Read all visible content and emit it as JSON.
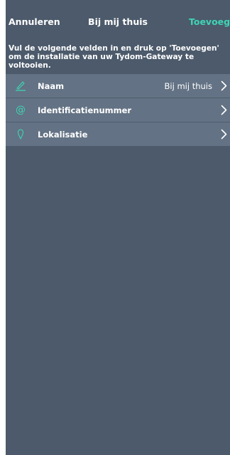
{
  "nav": {
    "cancel": "Annuleren",
    "title": "Bij mij thuis",
    "add": "Toevoegen"
  },
  "instructions": "Vul de volgende velden in en druk op 'Toevoegen' om de installatie van uw Tydom-Gateway te voltooien.",
  "fields": [
    {
      "label": "Naam",
      "value": "Bij mij thuis",
      "icon": "pencil-icon"
    },
    {
      "label": "Identificatienummer",
      "value": "",
      "icon": "at-sign-icon"
    },
    {
      "label": "Lokalisatie",
      "value": "",
      "icon": "location-pin-icon"
    }
  ],
  "colors": {
    "background": "#4c5a6b",
    "row_background": "#637284",
    "accent": "#3fd4b4"
  }
}
